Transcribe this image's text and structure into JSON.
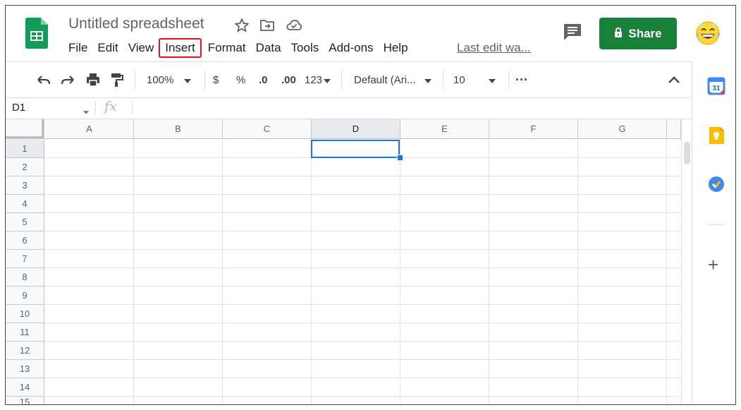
{
  "document": {
    "title": "Untitled spreadsheet",
    "last_edit": "Last edit wa..."
  },
  "menu": {
    "items": [
      "File",
      "Edit",
      "View",
      "Insert",
      "Format",
      "Data",
      "Tools",
      "Add-ons",
      "Help"
    ],
    "highlighted": "Insert"
  },
  "share": {
    "label": "Share",
    "color": "#188038"
  },
  "toolbar": {
    "zoom": "100%",
    "currency": "$",
    "percent": "%",
    "decimal_decrease": ".0",
    "decimal_increase": ".00",
    "number_format": "123",
    "font": "Default (Ari...",
    "font_size": "10",
    "more": "···"
  },
  "formula_bar": {
    "name_box": "D1",
    "fx": "fx"
  },
  "grid": {
    "columns": [
      "A",
      "B",
      "C",
      "D",
      "E",
      "F",
      "G"
    ],
    "rows": [
      "1",
      "2",
      "3",
      "4",
      "5",
      "6",
      "7",
      "8",
      "9",
      "10",
      "11",
      "12",
      "13",
      "14",
      "15"
    ],
    "selected_column": "D",
    "selected_row": "1",
    "selection_color": "#1a73e8"
  },
  "icons": {
    "header": [
      "sheets-logo",
      "star-icon",
      "move-to-folder-icon",
      "cloud-saved-icon",
      "comment-icon",
      "lock-icon",
      "avatar"
    ],
    "side_panel": [
      "calendar-icon",
      "keep-icon",
      "tasks-icon",
      "plus-icon"
    ]
  },
  "side_panel": {
    "calendar_day": "31"
  }
}
